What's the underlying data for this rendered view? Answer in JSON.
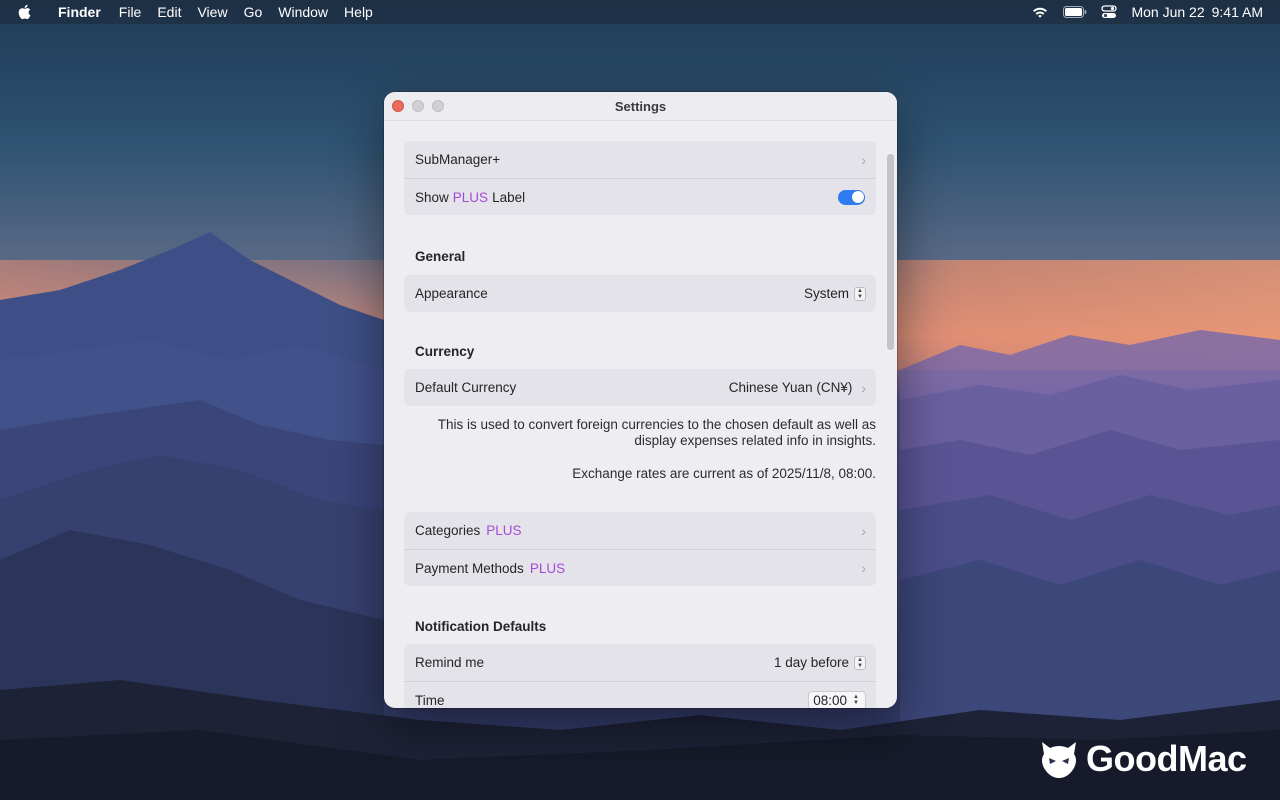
{
  "menubar": {
    "items": [
      "Finder",
      "File",
      "Edit",
      "View",
      "Go",
      "Window",
      "Help"
    ],
    "date": "Mon Jun 22",
    "time": "9:41 AM",
    "status_icons": [
      "wifi-icon",
      "battery-icon",
      "control-center-icon"
    ]
  },
  "window": {
    "title": "Settings"
  },
  "plus_group": {
    "submanager_label": "SubManager+",
    "show_label_prefix": "Show",
    "show_label_plus": "PLUS",
    "show_label_suffix": "Label",
    "show_label_enabled": true
  },
  "general": {
    "title": "General",
    "appearance_label": "Appearance",
    "appearance_value": "System"
  },
  "currency": {
    "title": "Currency",
    "default_label": "Default Currency",
    "default_value": "Chinese Yuan (CN¥)",
    "note_line1": "This is used to convert foreign currencies to the chosen default as well as",
    "note_line2": "display expenses related info in insights.",
    "rates_note": "Exchange rates are current as of 2025/11/8, 08:00."
  },
  "manage_group": {
    "categories_label": "Categories",
    "categories_badge": "PLUS",
    "payment_label": "Payment Methods",
    "payment_badge": "PLUS"
  },
  "notification": {
    "title": "Notification Defaults",
    "remind_label": "Remind me",
    "remind_value": "1 day before",
    "time_label": "Time",
    "time_value": "08:00"
  },
  "watermark": {
    "text": "GoodMac"
  },
  "colors": {
    "accent_plus": "#a44bd6",
    "toggle_on": "#2f7bf0",
    "close_button": "#ec6a5e"
  }
}
